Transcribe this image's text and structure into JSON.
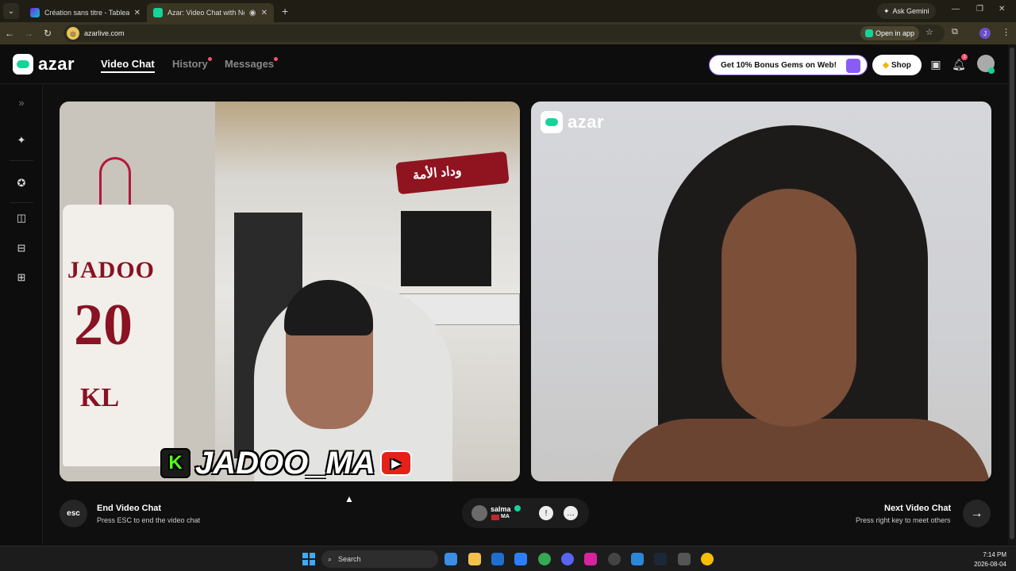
{
  "browser": {
    "tabs": [
      {
        "title": "Création sans titre - Tableau bla"
      },
      {
        "title": "Azar: Video Chat with New"
      }
    ],
    "ask_gemini": "Ask Gemini",
    "url": "azarlive.com",
    "open_in_app": "Open in app",
    "profile_initial": "J"
  },
  "app": {
    "logo_text": "azar",
    "nav": [
      {
        "label": "Video Chat"
      },
      {
        "label": "History"
      },
      {
        "label": "Messages"
      }
    ],
    "promo": "Get 10% Bonus Gems on Web!",
    "shop": "Shop",
    "notification_count": "1"
  },
  "left_video": {
    "overlay_name": "JADOO_MA",
    "jersey_name": "JADOO",
    "jersey_number": "20",
    "jersey_letters": "KL",
    "scarf_text": "وداد الأمة"
  },
  "right_video": {
    "watermark": "azar"
  },
  "controls": {
    "esc_label": "esc",
    "end_title": "End Video Chat",
    "end_sub": "Press ESC to end the video chat",
    "partner_name": "salma",
    "partner_country": "MA",
    "next_title": "Next Video Chat",
    "next_sub": "Press right key to meet others"
  },
  "taskbar": {
    "search": "Search",
    "time": "7:14 PM",
    "date": "2026-08-04"
  }
}
